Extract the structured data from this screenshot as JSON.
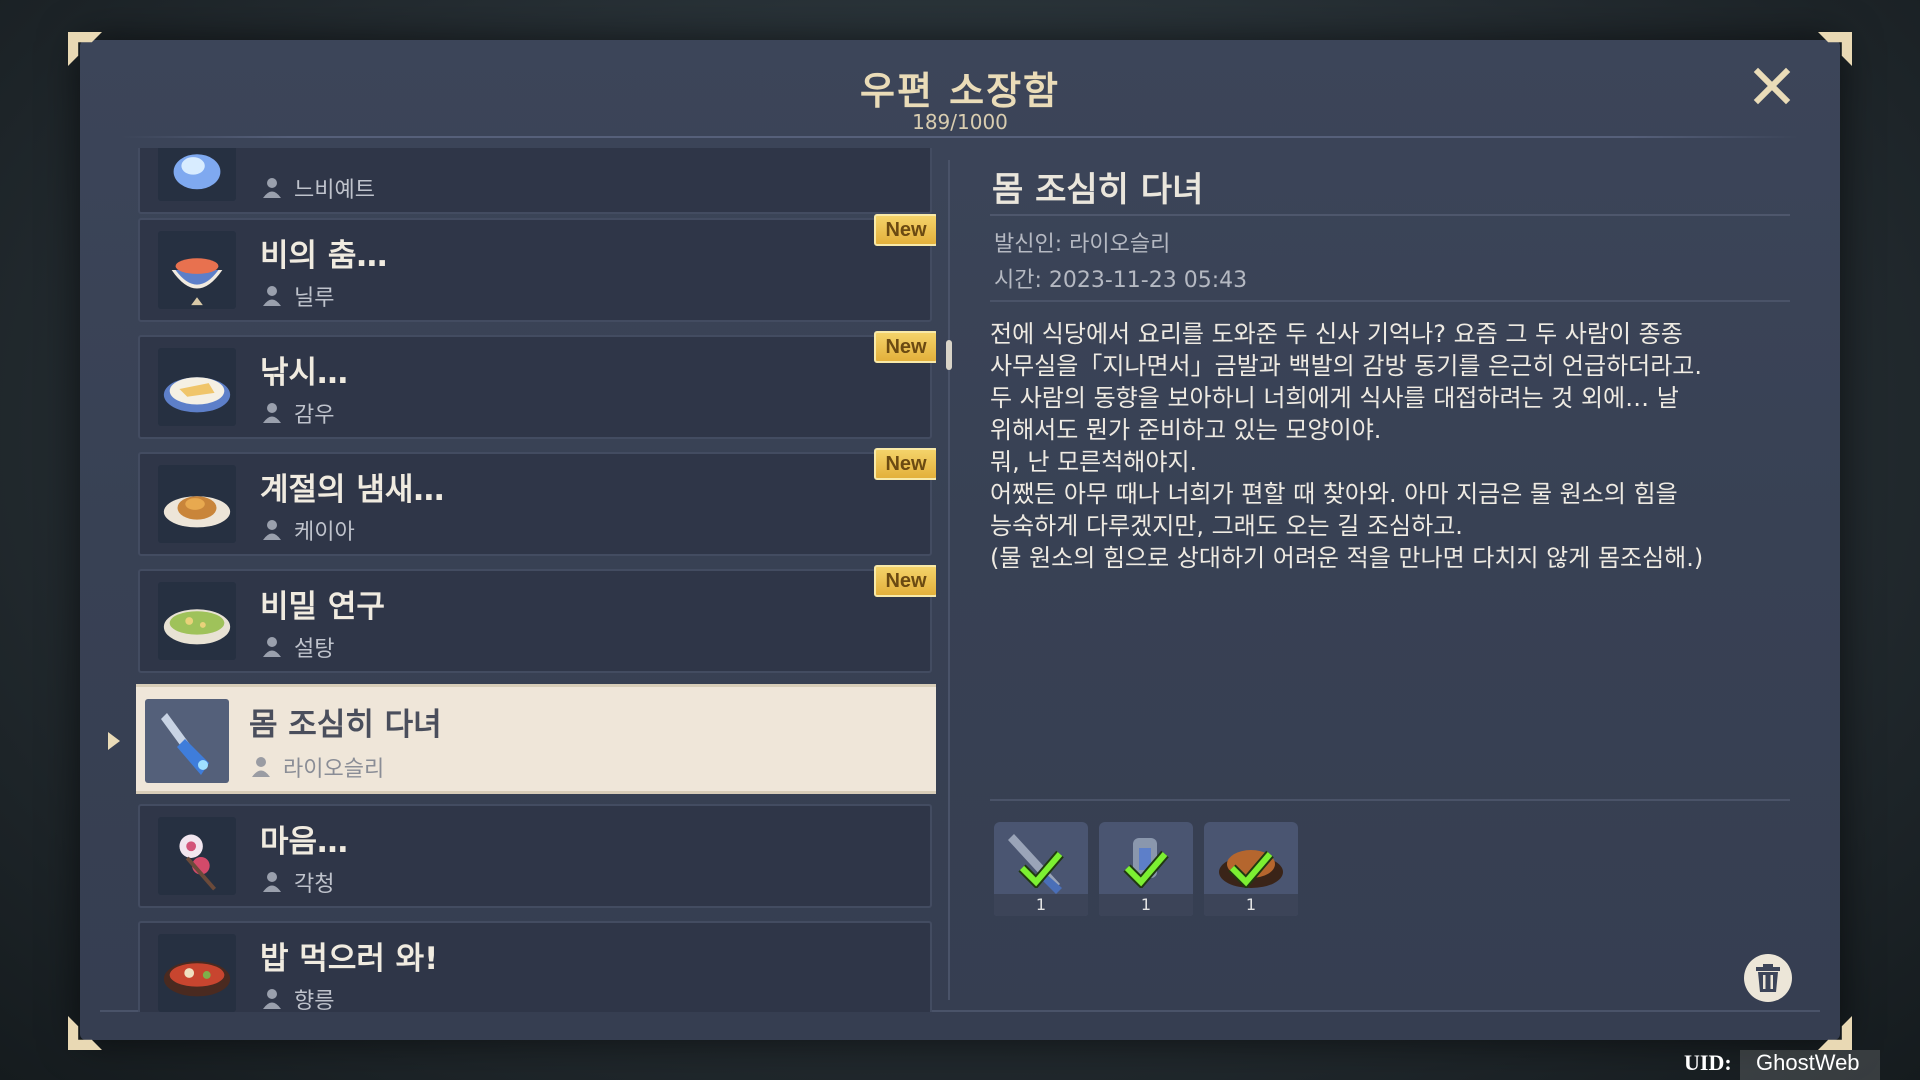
{
  "header": {
    "title": "우편 소장함",
    "count": "189/1000"
  },
  "mail_list": [
    {
      "title": "",
      "sender": "느비예트",
      "is_new": false,
      "selected": false,
      "icon": "crystal-icon"
    },
    {
      "title": "비의 춤…",
      "sender": "닐루",
      "is_new": true,
      "selected": false,
      "icon": "dessert-bowl-icon"
    },
    {
      "title": "낚시…",
      "sender": "감우",
      "is_new": true,
      "selected": false,
      "icon": "fish-dish-icon"
    },
    {
      "title": "계절의 냄새…",
      "sender": "케이아",
      "is_new": true,
      "selected": false,
      "icon": "roast-dish-icon"
    },
    {
      "title": "비밀 연구",
      "sender": "설탕",
      "is_new": true,
      "selected": false,
      "icon": "soup-bowl-icon"
    },
    {
      "title": "몸 조심히 다녀",
      "sender": "라이오슬리",
      "is_new": false,
      "selected": true,
      "icon": "weapon-icon"
    },
    {
      "title": "마음…",
      "sender": "각청",
      "is_new": false,
      "selected": false,
      "icon": "flower-icon"
    },
    {
      "title": "밥 먹으러 와!",
      "sender": "향릉",
      "is_new": false,
      "selected": false,
      "icon": "stew-pot-icon"
    }
  ],
  "new_label": "New",
  "detail": {
    "title": "몸 조심히 다녀",
    "sender_line": "발신인: 라이오슬리",
    "time_line": "시간: 2023-11-23 05:43",
    "body": [
      "전에 식당에서 요리를 도와준 두 신사 기억나? 요즘 그 두 사람이 종종",
      "사무실을「지나면서」금발과 백발의 감방 동기를 은근히 언급하더라고.",
      "두 사람의 동향을 보아하니 너희에게 식사를 대접하려는 것 외에… 날",
      "위해서도 뭔가 준비하고 있는 모양이야.",
      "뭐, 난 모른척해야지.",
      "어쨌든 아무 때나 너희가 편할 때 찾아와. 아마 지금은 물 원소의 힘을",
      "능숙하게 다루겠지만, 그래도 오는 길 조심하고.",
      "(물 원소의 힘으로 상대하기 어려운 적을 만나면 다치지 않게 몸조심해.)"
    ],
    "attachments": [
      {
        "icon": "sword-icon",
        "qty": "1",
        "claimed": true
      },
      {
        "icon": "lantern-icon",
        "qty": "1",
        "claimed": true
      },
      {
        "icon": "dish-icon",
        "qty": "1",
        "claimed": true
      }
    ]
  },
  "uid": {
    "label": "UID:",
    "value": "GhostWeb"
  },
  "colors": {
    "accent_gold": "#eadcb8",
    "new_badge": "#f4d36a",
    "claimed_check": "#7cf032"
  }
}
